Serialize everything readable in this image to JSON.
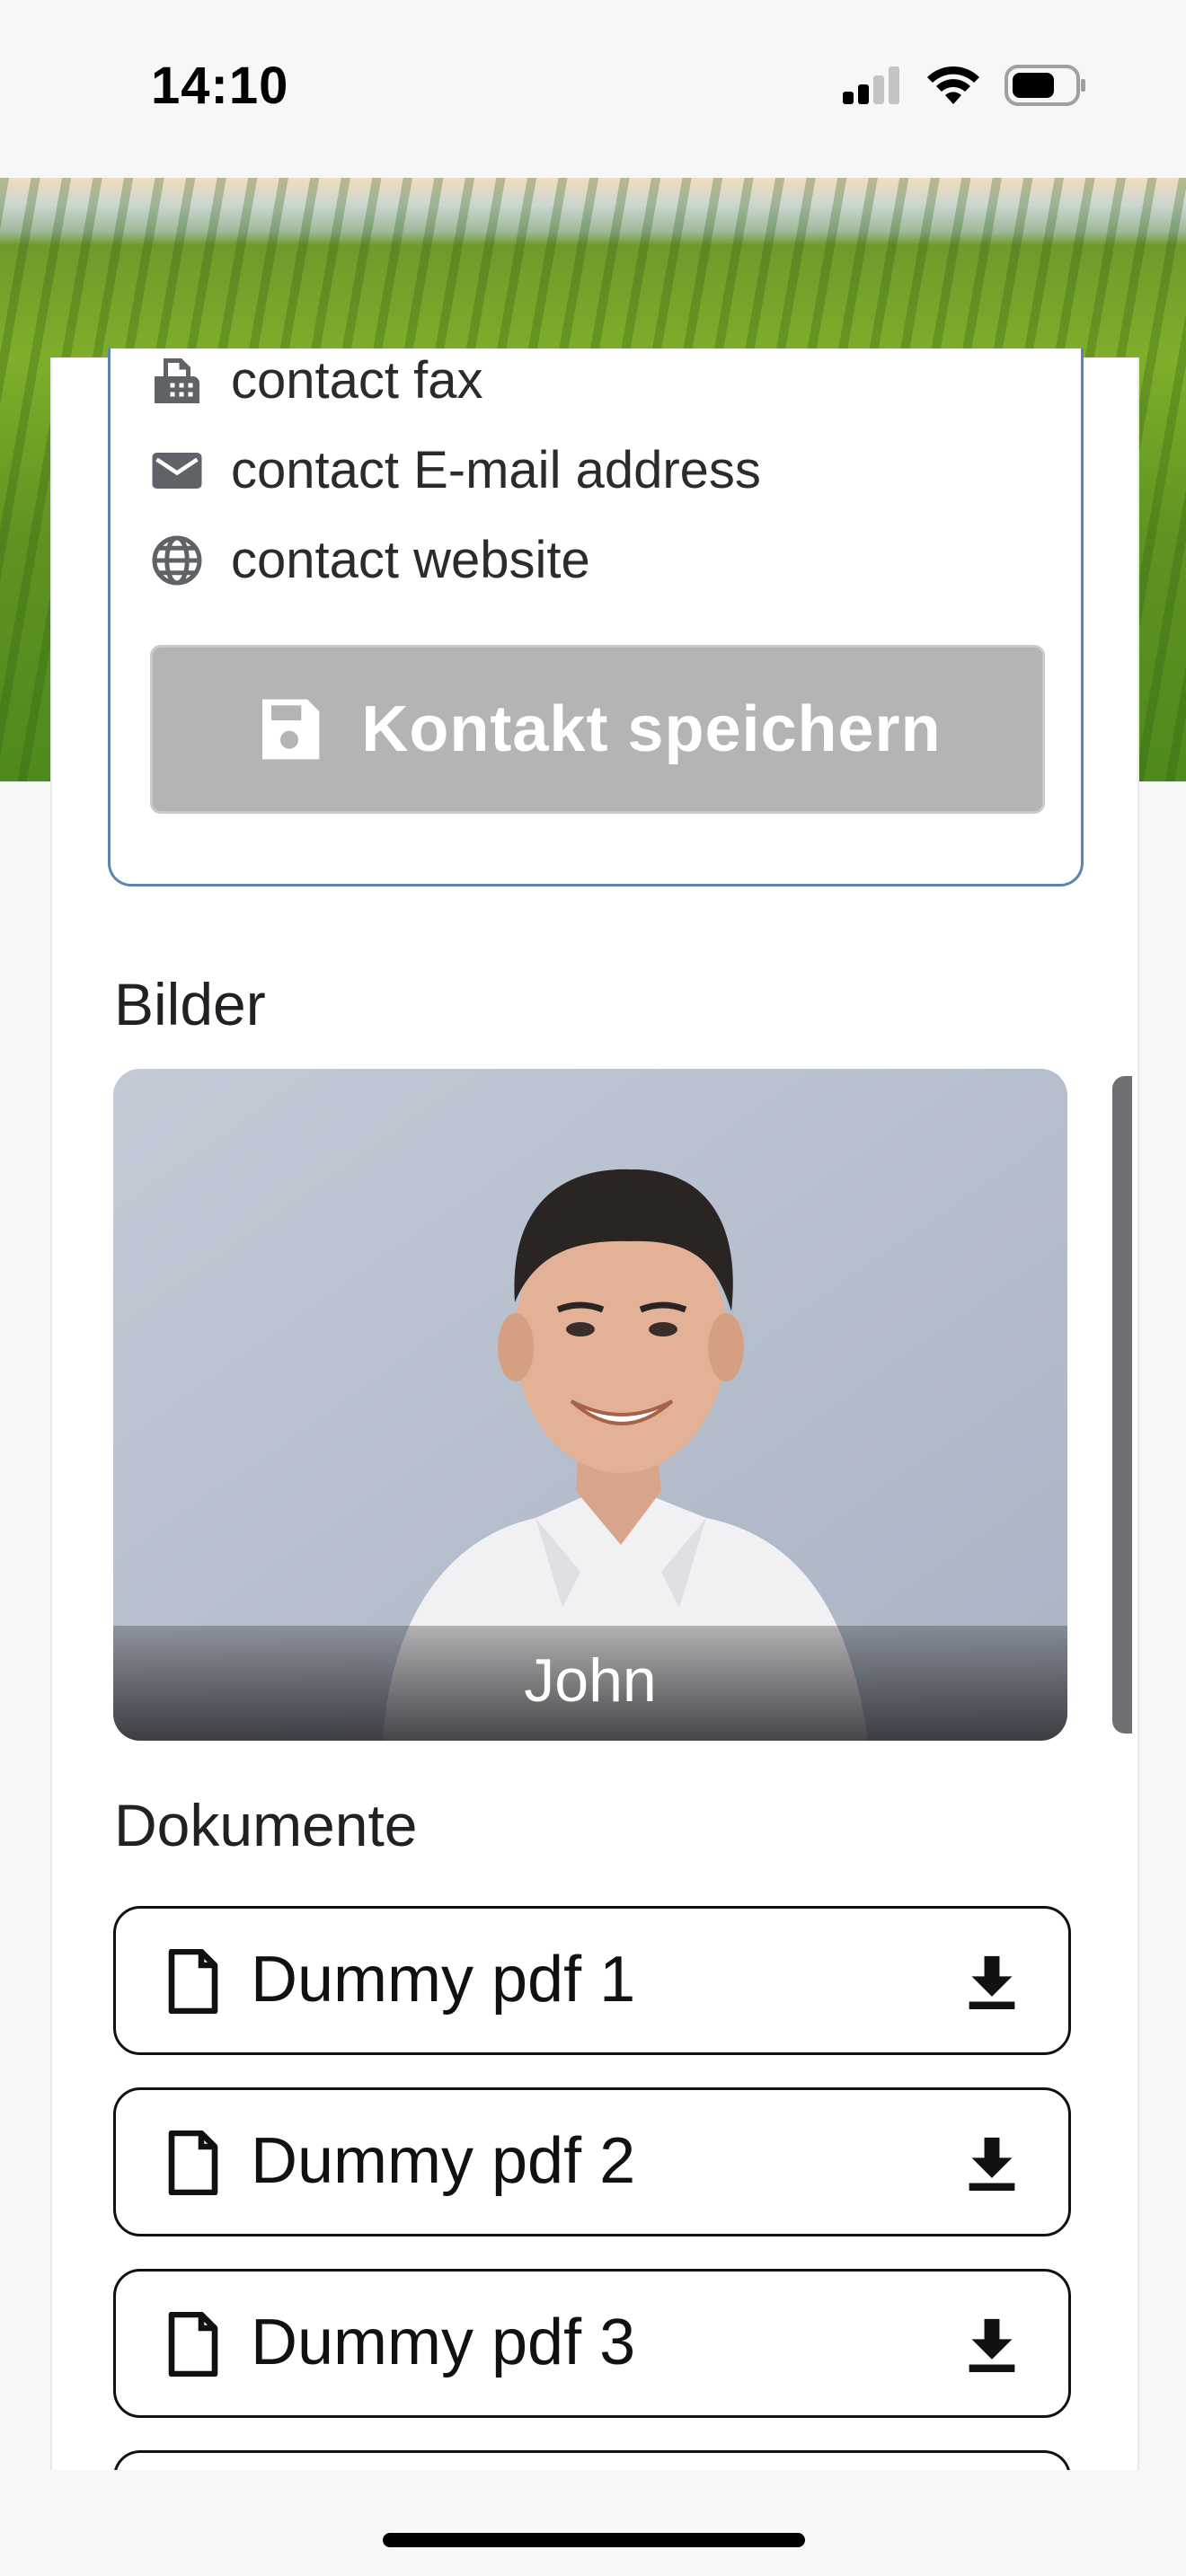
{
  "status_bar": {
    "time": "14:10"
  },
  "contact": {
    "fax": "contact fax",
    "email": "contact E-mail address",
    "website": "contact website",
    "save_label": "Kontakt speichern"
  },
  "images_section": {
    "title": "Bilder",
    "items": [
      {
        "caption": "John"
      }
    ]
  },
  "documents_section": {
    "title": "Dokumente",
    "items": [
      {
        "label": "Dummy pdf 1"
      },
      {
        "label": "Dummy pdf 2"
      },
      {
        "label": "Dummy pdf 3"
      }
    ]
  },
  "colors": {
    "accent_border": "#5a84b5",
    "button_disabled": "#b4b4b4"
  },
  "icons": [
    "fax-icon",
    "mail-icon",
    "globe-icon",
    "save-icon",
    "file-icon",
    "download-icon"
  ]
}
